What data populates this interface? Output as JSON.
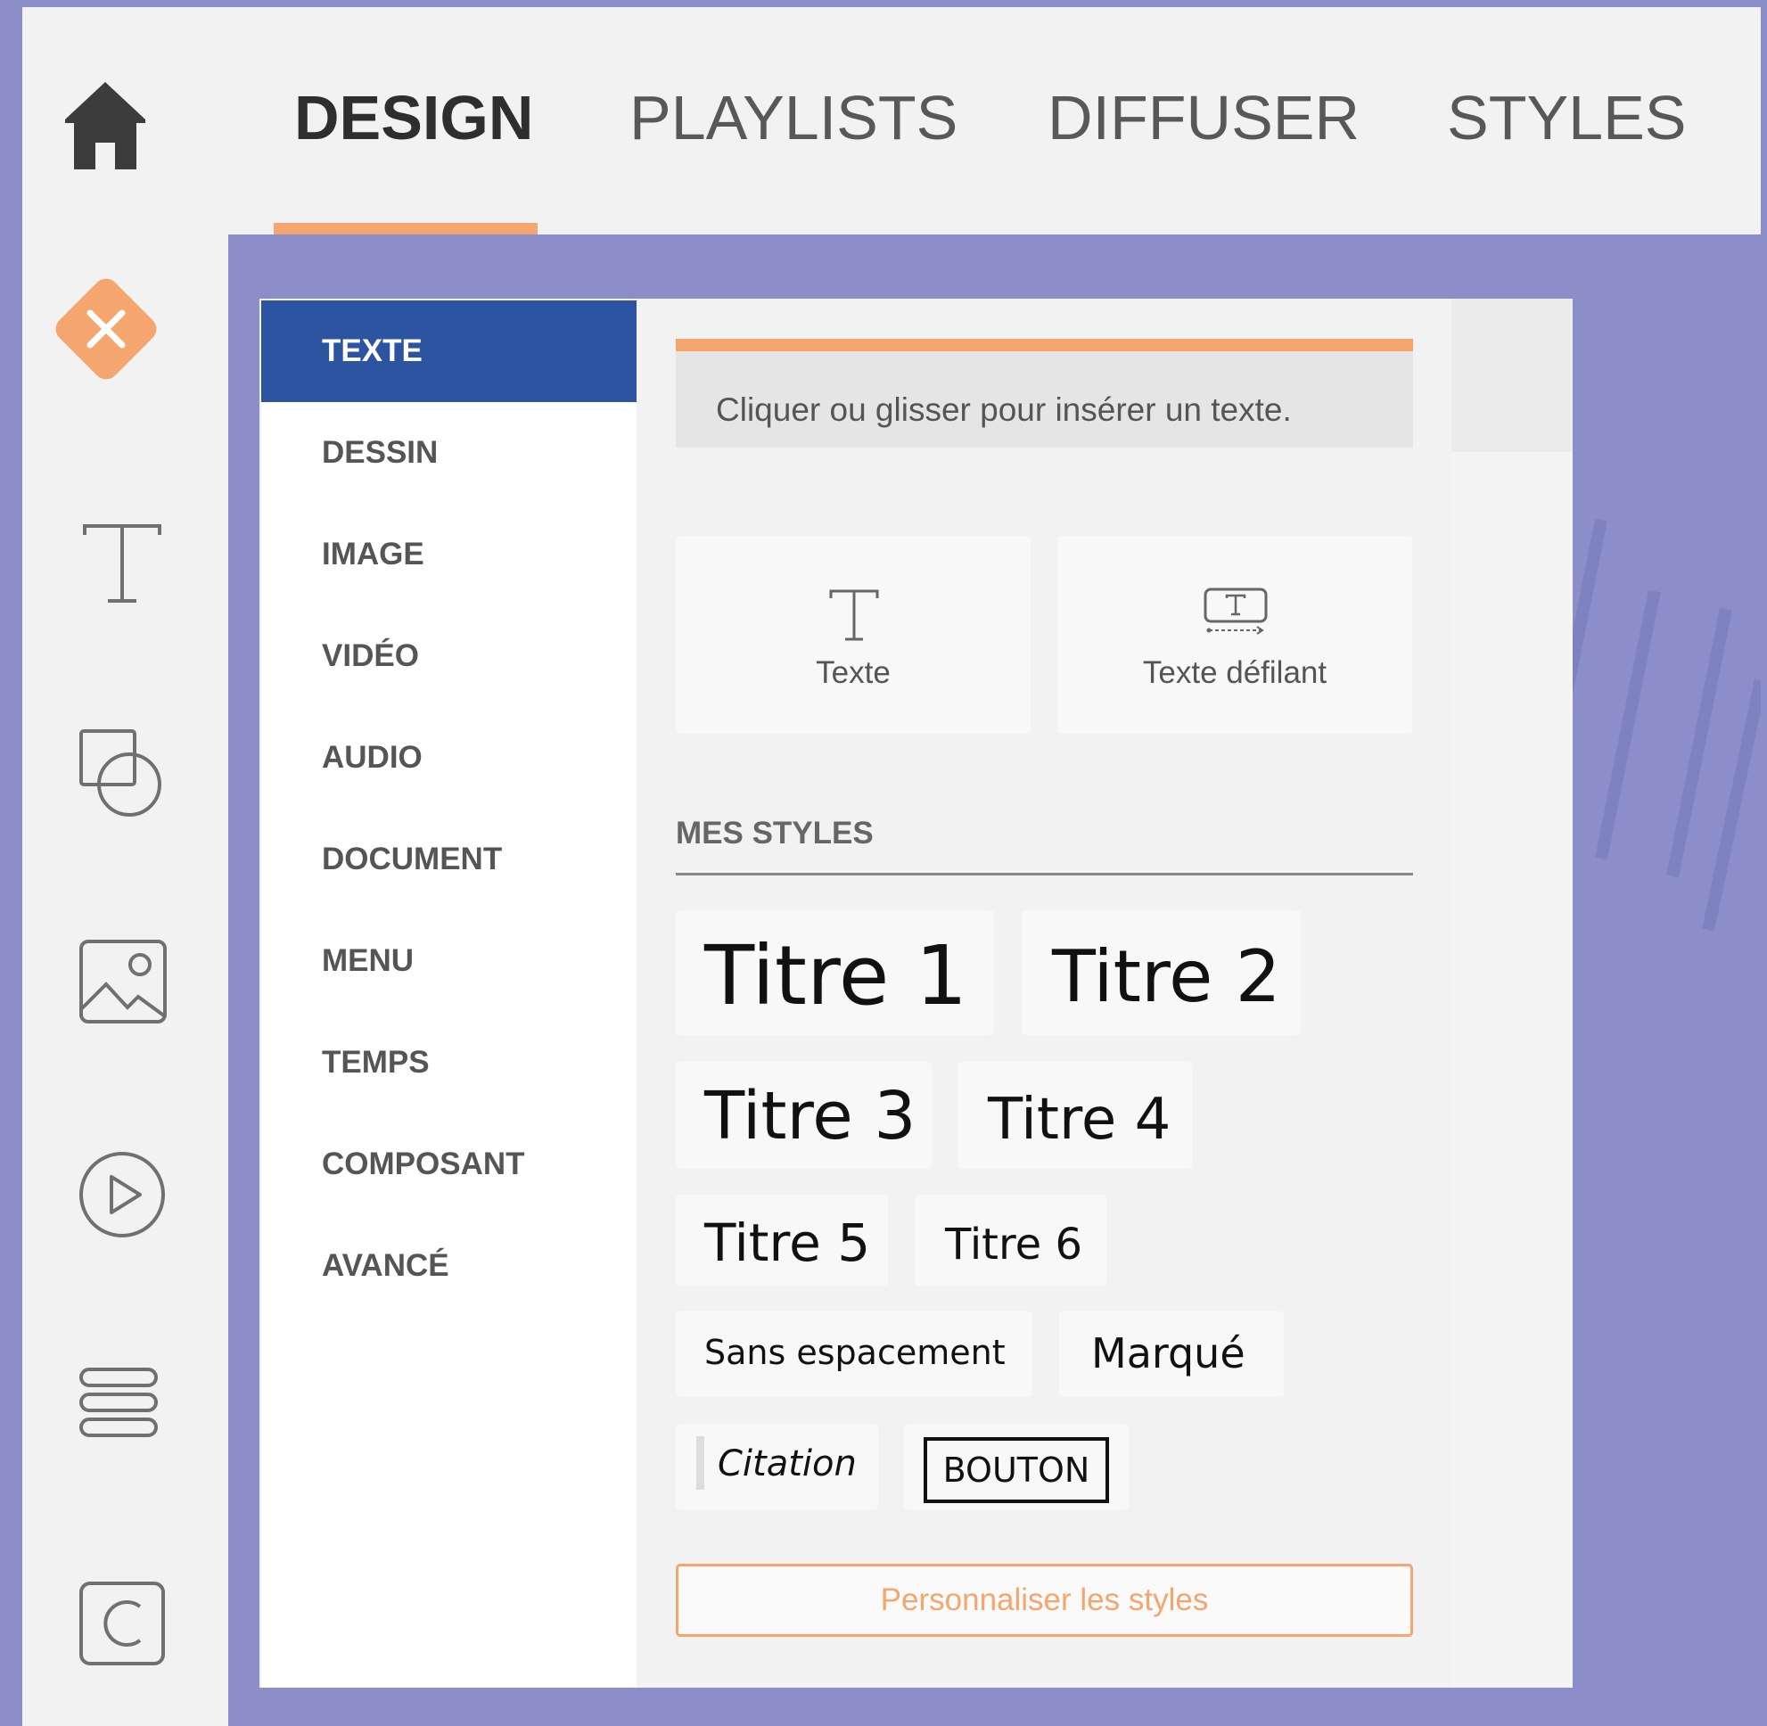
{
  "topnav": {
    "tabs": [
      {
        "label": "DESIGN",
        "active": true
      },
      {
        "label": "PLAYLISTS",
        "active": false
      },
      {
        "label": "DIFFUSER",
        "active": false
      },
      {
        "label": "STYLES",
        "active": false
      }
    ]
  },
  "leftbar": {
    "icons": [
      "home-icon",
      "close-icon",
      "text-icon",
      "shapes-icon",
      "image-icon",
      "play-icon",
      "menu-lines-icon",
      "component-icon"
    ]
  },
  "categories": {
    "items": [
      {
        "label": "TEXTE",
        "active": true
      },
      {
        "label": "DESSIN"
      },
      {
        "label": "IMAGE"
      },
      {
        "label": "VIDÉO"
      },
      {
        "label": "AUDIO"
      },
      {
        "label": "DOCUMENT"
      },
      {
        "label": "MENU"
      },
      {
        "label": "TEMPS"
      },
      {
        "label": "COMPOSANT"
      },
      {
        "label": "AVANCÉ"
      }
    ]
  },
  "content": {
    "hint": "Cliquer ou glisser pour insérer un texte.",
    "tiles": [
      {
        "label": "Texte",
        "icon": "text-icon"
      },
      {
        "label": "Texte défilant",
        "icon": "scrolling-text-icon"
      }
    ],
    "section_title": "MES STYLES",
    "styles": [
      "Titre 1",
      "Titre 2",
      "Titre 3",
      "Titre 4",
      "Titre 5",
      "Titre 6",
      "Sans espacement",
      "Marqué",
      "Citation",
      "BOUTON"
    ],
    "customize_label": "Personnaliser les styles"
  },
  "colors": {
    "accent": "#f4a66e",
    "active_category": "#2c54a0",
    "background": "#8b8ec8"
  }
}
